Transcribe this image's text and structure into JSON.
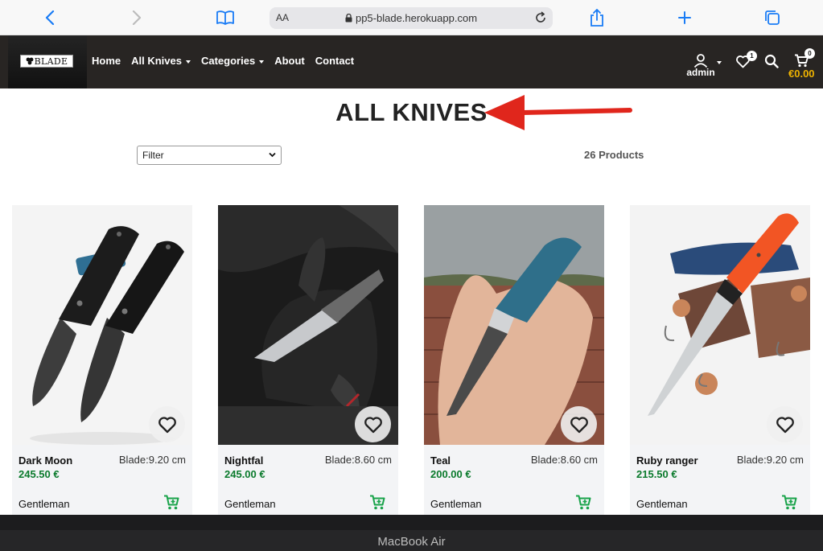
{
  "browser": {
    "text_size_label": "AA",
    "url": "pp5-blade.herokuapp.com"
  },
  "site": {
    "logo_text": "BLADE",
    "nav": {
      "home": "Home",
      "all_knives": "All Knives",
      "categories": "Categories",
      "about": "About",
      "contact": "Contact"
    },
    "user_label": "admin",
    "wishlist_count": "1",
    "cart_count": "0",
    "cart_total": "€0.00"
  },
  "page": {
    "title": "ALL KNIVES",
    "filter_value": "Filter",
    "product_count": "26 Products"
  },
  "products": [
    {
      "name": "Dark Moon",
      "blade": "Blade:9.20 cm",
      "price": "245.50 €",
      "category": "Gentleman"
    },
    {
      "name": "Nightfal",
      "blade": "Blade:8.60 cm",
      "price": "245.00 €",
      "category": "Gentleman"
    },
    {
      "name": "Teal",
      "blade": "Blade:8.60 cm",
      "price": "200.00 €",
      "category": "Gentleman"
    },
    {
      "name": "Ruby ranger",
      "blade": "Blade:9.20 cm",
      "price": "215.50 €",
      "category": "Gentleman"
    }
  ],
  "device_label": "MacBook Air",
  "colors": {
    "nav_bg": "#282523",
    "price_green": "#0a7a2c",
    "cart_icon_green": "#19a34a",
    "cart_total_gold": "#f0b400",
    "safari_blue": "#1a7cf5",
    "annotation_arrow_red": "#e0261c"
  },
  "icons": [
    "back-icon",
    "forward-icon",
    "bookmarks-icon",
    "lock-icon",
    "reload-icon",
    "share-icon",
    "new-tab-icon",
    "tabs-icon",
    "user-icon",
    "heart-icon",
    "search-icon",
    "cart-icon",
    "add-to-cart-icon"
  ]
}
